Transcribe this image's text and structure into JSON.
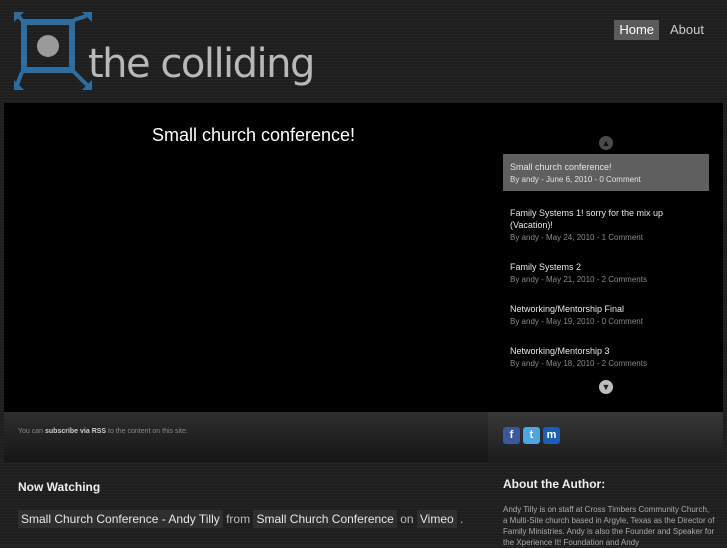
{
  "site": {
    "logo_text": "the colliding"
  },
  "nav": [
    {
      "label": "Home"
    },
    {
      "label": "About"
    }
  ],
  "feature": {
    "title": "Small church conference!",
    "posts": [
      {
        "title": "Small church conference!",
        "meta": "By andy - June 6, 2010 - 0 Comment"
      },
      {
        "title": "Family Systems 1! sorry for the mix up (Vacation)!",
        "meta": "By andy - May 24, 2010 - 1 Comment"
      },
      {
        "title": "Family Systems 2",
        "meta": "By andy - May 21, 2010 - 2 Comments"
      },
      {
        "title": "Networking/Mentorship Final",
        "meta": "By andy - May 19, 2010 - 0 Comment"
      },
      {
        "title": "Networking/Mentorship 3",
        "meta": "By andy - May 18, 2010 - 2 Comments"
      }
    ]
  },
  "footer": {
    "rss_prefix": "You can",
    "rss_link": "subscribe via RSS",
    "rss_suffix": "to the content on this site.",
    "social_icons": [
      "facebook-icon",
      "twitter-icon",
      "myspace-icon"
    ]
  },
  "now_watching": {
    "heading": "Now Watching",
    "video_title": "Small Church Conference - Andy Tilly",
    "from": "from",
    "channel": "Small Church Conference",
    "on": "on",
    "site": "Vimeo",
    "end": "."
  },
  "author": {
    "heading": "About the Author:",
    "text": "Andy Tilly is on staff at Cross Timbers Community Church, a Multi-Site church based in Argyle, Texas as the Director of Family Ministries. Andy is also the Founder and Speaker for the Xperience It! Foundation and Andy"
  }
}
